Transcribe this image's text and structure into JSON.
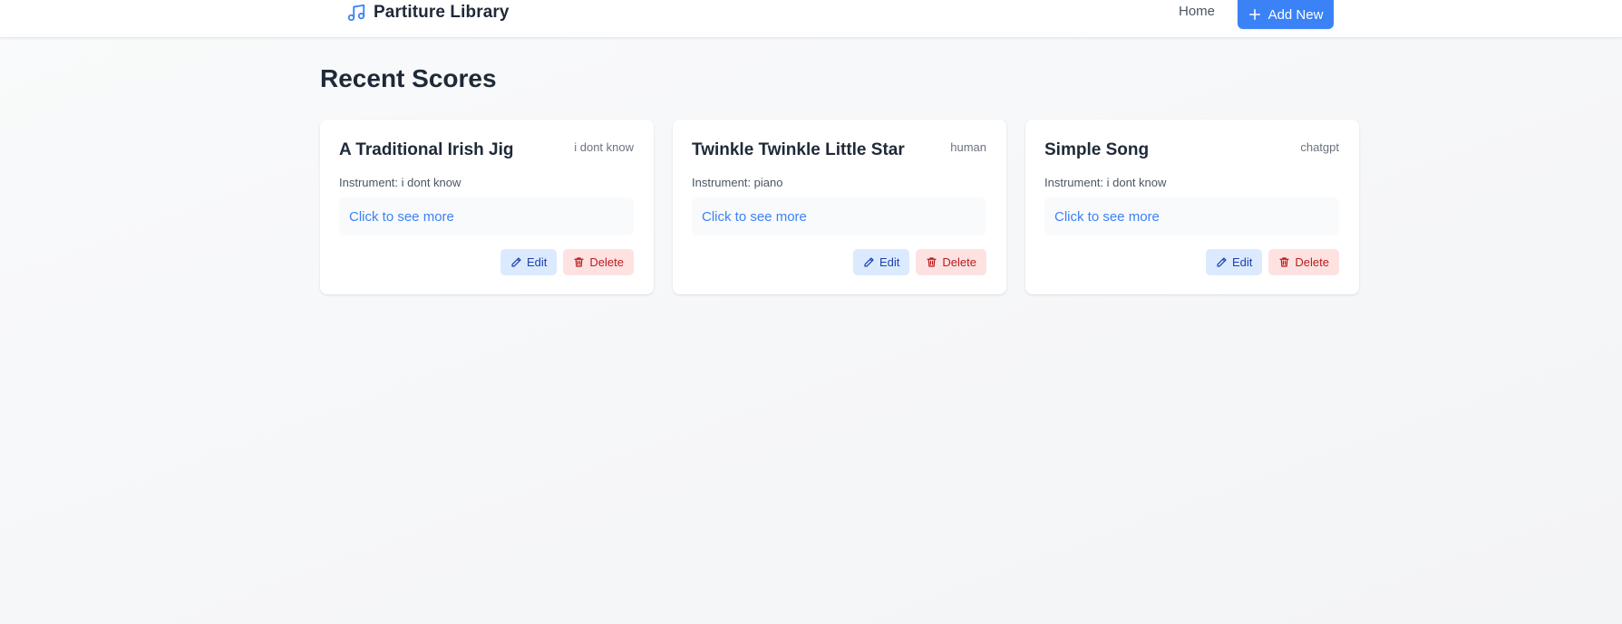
{
  "header": {
    "brand_title": "Partiture Library",
    "brand_icon": "music-note-icon",
    "nav_home": "Home",
    "add_new_label": "Add New",
    "add_icon": "plus-icon"
  },
  "main": {
    "title": "Recent Scores",
    "scores": [
      {
        "title": "A Traditional Irish Jig",
        "author": "i dont know",
        "instrument": "Instrument: i dont know",
        "more": "Click to see more",
        "edit_label": "Edit",
        "delete_label": "Delete"
      },
      {
        "title": "Twinkle Twinkle Little Star",
        "author": "human",
        "instrument": "Instrument: piano",
        "more": "Click to see more",
        "edit_label": "Edit",
        "delete_label": "Delete"
      },
      {
        "title": "Simple Song",
        "author": "chatgpt",
        "instrument": "Instrument: i dont know",
        "more": "Click to see more",
        "edit_label": "Edit",
        "delete_label": "Delete"
      }
    ]
  },
  "colors": {
    "accent": "#3b82f6",
    "edit_bg": "#dbeafe",
    "edit_text": "#1e40af",
    "delete_bg": "#fee2e2",
    "delete_text": "#b91c1c",
    "page_bg": "#f3f4f6"
  }
}
